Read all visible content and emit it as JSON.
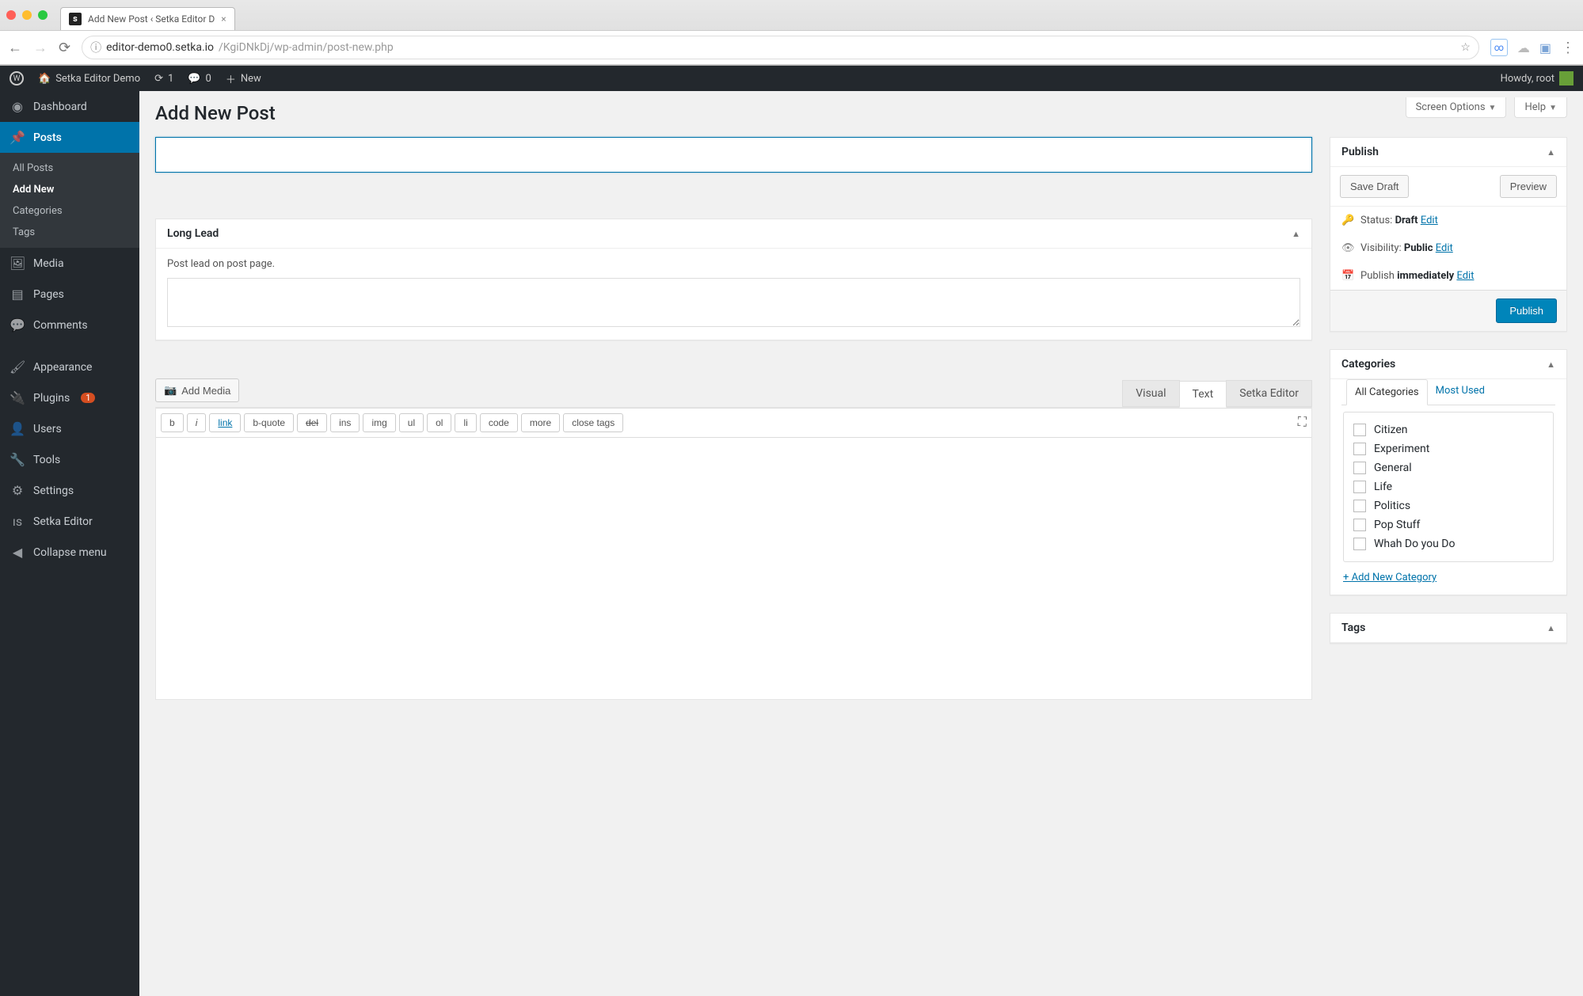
{
  "browser": {
    "tab_title": "Add New Post ‹ Setka Editor D",
    "favicon_letter": "s",
    "url_host": "editor-demo0.setka.io",
    "url_path": "/KgiDNkDj/wp-admin/post-new.php"
  },
  "adminbar": {
    "site_name": "Setka Editor Demo",
    "updates_count": "1",
    "comments_count": "0",
    "new_label": "New",
    "howdy": "Howdy, root"
  },
  "sidebar": {
    "dashboard": "Dashboard",
    "posts": "Posts",
    "posts_submenu": {
      "all_posts": "All Posts",
      "add_new": "Add New",
      "categories": "Categories",
      "tags": "Tags"
    },
    "media": "Media",
    "pages": "Pages",
    "comments": "Comments",
    "appearance": "Appearance",
    "plugins": "Plugins",
    "plugins_badge": "1",
    "users": "Users",
    "tools": "Tools",
    "settings": "Settings",
    "setka_editor": "Setka Editor",
    "collapse": "Collapse menu"
  },
  "screen_options": {
    "screen_options": "Screen Options",
    "help": "Help"
  },
  "page": {
    "heading": "Add New Post",
    "title_value": "",
    "title_placeholder": ""
  },
  "long_lead": {
    "title": "Long Lead",
    "desc": "Post lead on post page.",
    "value": ""
  },
  "editor": {
    "add_media": "Add Media",
    "tabs": {
      "visual": "Visual",
      "text": "Text",
      "setka": "Setka Editor"
    },
    "quicktags": [
      "b",
      "i",
      "link",
      "b-quote",
      "del",
      "ins",
      "img",
      "ul",
      "ol",
      "li",
      "code",
      "more",
      "close tags"
    ]
  },
  "publish": {
    "title": "Publish",
    "save_draft": "Save Draft",
    "preview": "Preview",
    "status_label": "Status:",
    "status_value": "Draft",
    "visibility_label": "Visibility:",
    "visibility_value": "Public",
    "schedule_label": "Publish",
    "schedule_value": "immediately",
    "edit": "Edit",
    "publish_btn": "Publish"
  },
  "categories": {
    "title": "Categories",
    "tab_all": "All Categories",
    "tab_most": "Most Used",
    "items": [
      "Citizen",
      "Experiment",
      "General",
      "Life",
      "Politics",
      "Pop Stuff",
      "Whah Do you Do"
    ],
    "add_new": "+ Add New Category"
  },
  "tags": {
    "title": "Tags"
  }
}
